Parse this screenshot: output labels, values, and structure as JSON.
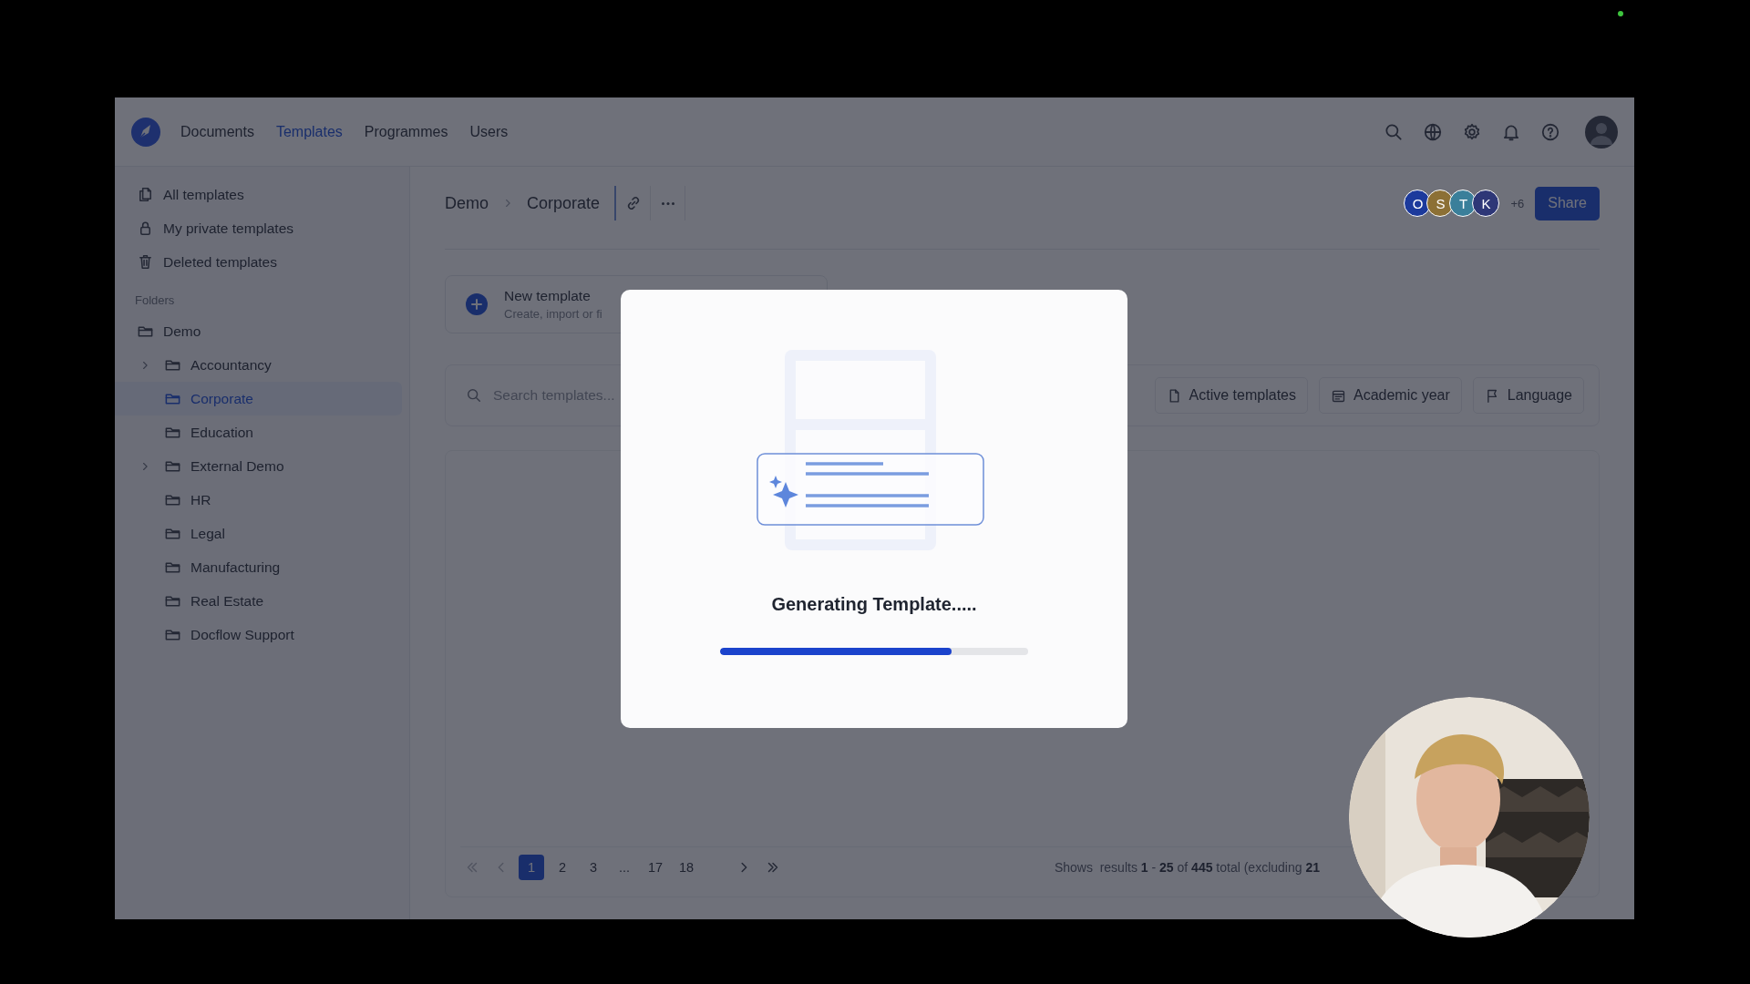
{
  "topbar": {
    "nav": [
      {
        "label": "Documents",
        "selected": false
      },
      {
        "label": "Templates",
        "selected": true
      },
      {
        "label": "Programmes",
        "selected": false
      },
      {
        "label": "Users",
        "selected": false
      }
    ]
  },
  "sidebar": {
    "items": [
      {
        "label": "All templates",
        "kind": "all"
      },
      {
        "label": "My private templates",
        "kind": "private"
      },
      {
        "label": "Deleted templates",
        "kind": "deleted"
      }
    ],
    "folders_heading": "Folders",
    "folders": [
      {
        "label": "Demo",
        "selected": false,
        "children": [
          {
            "label": "Accountancy",
            "selected": false,
            "has_subfolders": true
          },
          {
            "label": "Corporate",
            "selected": true,
            "has_subfolders": false
          },
          {
            "label": "Education",
            "selected": false,
            "has_subfolders": false
          },
          {
            "label": "External Demo",
            "selected": false,
            "has_subfolders": true
          },
          {
            "label": "HR",
            "selected": false,
            "has_subfolders": false
          },
          {
            "label": "Legal",
            "selected": false,
            "has_subfolders": false
          },
          {
            "label": "Manufacturing",
            "selected": false,
            "has_subfolders": false
          },
          {
            "label": "Real Estate",
            "selected": false,
            "has_subfolders": false
          },
          {
            "label": "Docflow Support",
            "selected": false,
            "has_subfolders": false
          }
        ]
      }
    ]
  },
  "header": {
    "breadcrumb": [
      "Demo",
      "Corporate"
    ],
    "collaborators": [
      {
        "initial": "O",
        "color": "#1c3a9c"
      },
      {
        "initial": "S",
        "color": "#8c7035"
      },
      {
        "initial": "T",
        "color": "#3a7f9a"
      },
      {
        "initial": "K",
        "color": "#2e3777"
      }
    ],
    "more_count": "+6",
    "share": "Share"
  },
  "new_template": {
    "title": "New template",
    "subtitle": "Create, import or fi"
  },
  "filters": {
    "search": {
      "placeholder": "Search templates..."
    },
    "buttons": [
      {
        "label": "Active templates",
        "kind": "file"
      },
      {
        "label": "Academic year",
        "kind": "calendar"
      },
      {
        "label": "Language",
        "kind": "flag"
      }
    ]
  },
  "pagination": {
    "pages": [
      {
        "label": "1",
        "selected": true
      },
      {
        "label": "2",
        "selected": false
      },
      {
        "label": "3",
        "selected": false
      },
      {
        "label": "...",
        "selected": false
      },
      {
        "label": "17",
        "selected": false
      },
      {
        "label": "18",
        "selected": false
      }
    ],
    "summary": "Shows  results **1** - **25** of **445** total (excluding **21**"
  },
  "modal": {
    "title": "Generating Template.....",
    "progress": {
      "level": 0.75
    }
  }
}
